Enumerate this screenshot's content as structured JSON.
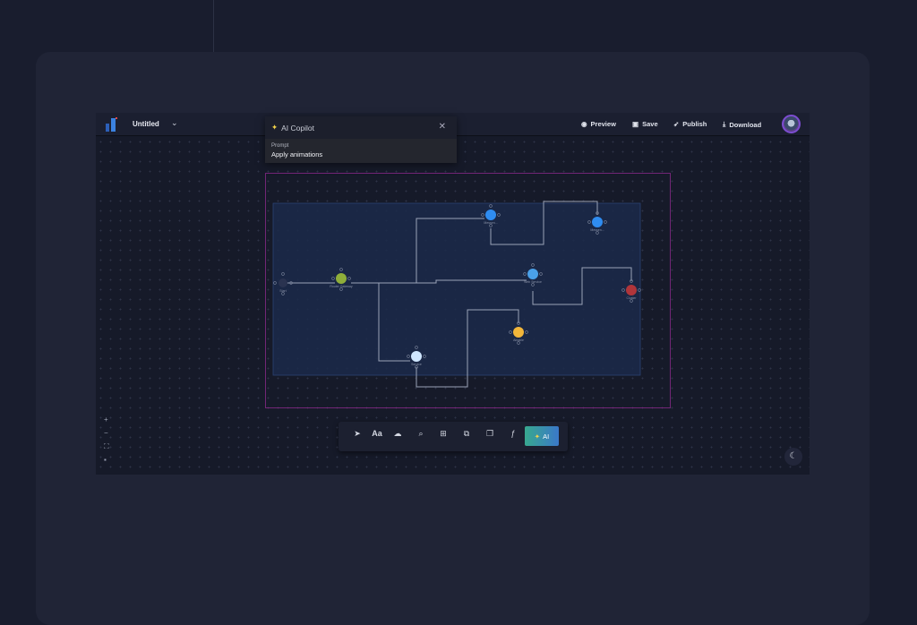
{
  "header": {
    "title": "Untitled",
    "actions": [
      {
        "icon": "eye-icon",
        "label": "Preview"
      },
      {
        "icon": "save-icon",
        "label": "Save"
      },
      {
        "icon": "rocket-icon",
        "label": "Publish"
      },
      {
        "icon": "download-icon",
        "label": "Download"
      }
    ]
  },
  "copilot": {
    "title": "AI Copilot",
    "prompt_label": "Prompt",
    "prompt_value": "Apply animations"
  },
  "toolbar": {
    "tools": [
      "pointer-icon",
      "text-icon",
      "shapes-icon",
      "search-icon",
      "grid-icon",
      "components-icon",
      "copy-icon",
      "formula-icon"
    ],
    "text_glyph": "Aa",
    "ai_label": "AI"
  },
  "zoom_controls": {
    "plus": "+",
    "minus": "−"
  },
  "diagram": {
    "nodes": [
      {
        "id": "start",
        "label": "Start",
        "color": "#2a3350"
      },
      {
        "id": "router",
        "label": "Router Gateway",
        "color": "#8fae3a"
      },
      {
        "id": "msg1",
        "label": "Messen...",
        "color": "#2f8cf0"
      },
      {
        "id": "msg2",
        "label": "Messen...",
        "color": "#2f8cf0"
      },
      {
        "id": "web",
        "label": "Web Service",
        "color": "#4aa0e8"
      },
      {
        "id": "cluster",
        "label": "Cluster",
        "color": "#b0353a"
      },
      {
        "id": "airtable",
        "label": "Airtable",
        "color": "#f2b63a"
      },
      {
        "id": "service",
        "label": "Service",
        "color": "#cfe6ff"
      }
    ]
  },
  "colors": {
    "accent_start": "#38a88f",
    "accent_end": "#3a78c8",
    "selection": "#8a2a8a",
    "group": "#1b2a4a"
  }
}
